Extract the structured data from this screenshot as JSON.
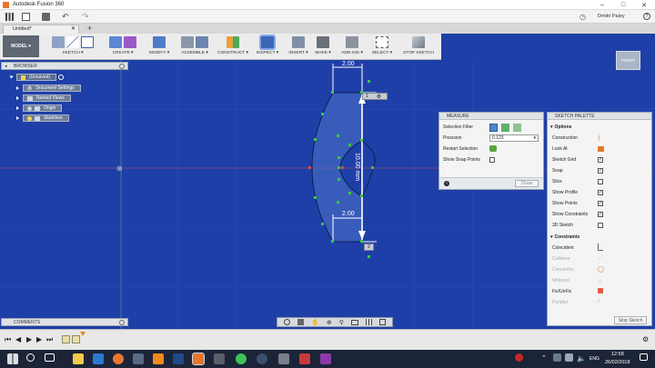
{
  "window": {
    "title": "Autodesk Fusion 360"
  },
  "appbar": {
    "user": "Dmitri Paley"
  },
  "tab": {
    "label": "Untitled*"
  },
  "toolbar": {
    "workspace": "MODEL ▾",
    "groups": [
      "SKETCH ▾",
      "CREATE ▾",
      "MODIFY ▾",
      "ASSEMBLE ▾",
      "CONSTRUCT ▾",
      "INSPECT ▾",
      "INSERT ▾",
      "MAKE ▾",
      "ADD-INS ▾",
      "SELECT ▾",
      "STOP SKETCH"
    ]
  },
  "viewcube": {
    "label": "FRONT"
  },
  "browser": {
    "title": "BROWSER",
    "root": "(Unsaved)",
    "items": [
      "Document Settings",
      "Named Views",
      "Origin",
      "Sketches"
    ]
  },
  "comments": {
    "title": "COMMENTS"
  },
  "sketch": {
    "dim_top": "2.00",
    "dim_bottom": "2.00",
    "dim_vertical": "10.00 mm",
    "badge_top": "1",
    "badge_bottom": "2"
  },
  "measure": {
    "title": "MEASURE",
    "selection_filter_label": "Selection Filter",
    "precision_label": "Precision",
    "precision_value": "0.123",
    "restart_label": "Restart Selection",
    "snap_label": "Show Snap Points",
    "close_label": "Close"
  },
  "palette": {
    "title": "SKETCH PALETTE",
    "options_header": "Options",
    "options": [
      {
        "label": "Construction",
        "control": "icon"
      },
      {
        "label": "Look At",
        "control": "icon"
      },
      {
        "label": "Sketch Grid",
        "checked": true
      },
      {
        "label": "Snap",
        "checked": true
      },
      {
        "label": "Slice",
        "checked": false
      },
      {
        "label": "Show Profile",
        "checked": true
      },
      {
        "label": "Show Points",
        "checked": true
      },
      {
        "label": "Show Constraints",
        "checked": true
      },
      {
        "label": "3D Sketch",
        "checked": false
      }
    ],
    "constraints_header": "Constraints",
    "constraints": [
      {
        "label": "Coincident",
        "enabled": true
      },
      {
        "label": "Collinear",
        "enabled": false
      },
      {
        "label": "Concentric",
        "enabled": false
      },
      {
        "label": "Midpoint",
        "enabled": false
      },
      {
        "label": "Fix/UnFix",
        "enabled": true
      },
      {
        "label": "Parallel",
        "enabled": false
      }
    ],
    "stop_label": "Stop Sketch"
  },
  "taskbar": {
    "time": "12:58",
    "date": "26/02/2018",
    "lang": "ENG"
  },
  "colors": {
    "canvas": "#1f3fa8",
    "profile": "#4f74c8",
    "dimension": "#ffffff",
    "point": "#3ec93e"
  }
}
